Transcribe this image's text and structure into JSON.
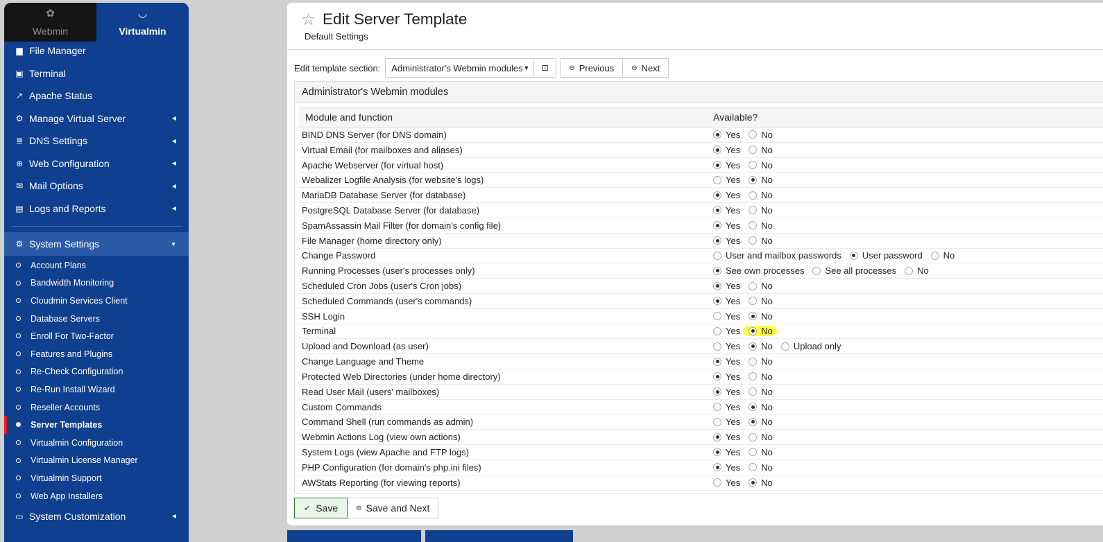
{
  "sidebar": {
    "switch": {
      "webmin": "Webmin",
      "virtualmin": "Virtualmin"
    },
    "items": [
      {
        "label": "File Manager",
        "icon": "folder-icon",
        "glyph": "▆"
      },
      {
        "label": "Terminal",
        "icon": "terminal-icon",
        "glyph": "▣"
      },
      {
        "label": "Apache Status",
        "icon": "external-link-icon",
        "glyph": "↗"
      },
      {
        "label": "Manage Virtual Server",
        "icon": "gears-icon",
        "glyph": "⚙"
      },
      {
        "label": "DNS Settings",
        "icon": "server-icon",
        "glyph": "≣"
      },
      {
        "label": "Web Configuration",
        "icon": "globe-icon",
        "glyph": "⊕"
      },
      {
        "label": "Mail Options",
        "icon": "envelope-icon",
        "glyph": "✉"
      },
      {
        "label": "Logs and Reports",
        "icon": "document-icon",
        "glyph": "▤"
      }
    ],
    "system_settings": {
      "label": "System Settings",
      "icon": "gear-icon"
    },
    "sub_items": [
      "Account Plans",
      "Bandwidth Monitoring",
      "Cloudmin Services Client",
      "Database Servers",
      "Enroll For Two-Factor",
      "Features and Plugins",
      "Re-Check Configuration",
      "Re-Run Install Wizard",
      "Reseller Accounts",
      "Server Templates",
      "Virtualmin Configuration",
      "Virtualmin License Manager",
      "Virtualmin Support",
      "Web App Installers"
    ],
    "current_sub": "Server Templates",
    "customization": {
      "label": "System Customization",
      "icon": "laptop-icon"
    }
  },
  "header": {
    "title": "Edit Server Template",
    "subtitle": "Default Settings"
  },
  "toolbar": {
    "section_label": "Edit template section:",
    "section_value": "Administrator's Webmin modules",
    "previous": "Previous",
    "next": "Next"
  },
  "panel": {
    "title": "Administrator's Webmin modules",
    "col1": "Module and function",
    "col2": "Available?",
    "rows": [
      {
        "name": "BIND DNS Server (for DNS domain)",
        "options": [
          "Yes",
          "No"
        ],
        "selected": 0
      },
      {
        "name": "Virtual Email (for mailboxes and aliases)",
        "options": [
          "Yes",
          "No"
        ],
        "selected": 0
      },
      {
        "name": "Apache Webserver (for virtual host)",
        "options": [
          "Yes",
          "No"
        ],
        "selected": 0
      },
      {
        "name": "Webalizer Logfile Analysis (for website's logs)",
        "options": [
          "Yes",
          "No"
        ],
        "selected": 1
      },
      {
        "name": "MariaDB Database Server (for database)",
        "options": [
          "Yes",
          "No"
        ],
        "selected": 0
      },
      {
        "name": "PostgreSQL Database Server (for database)",
        "options": [
          "Yes",
          "No"
        ],
        "selected": 0
      },
      {
        "name": "SpamAssassin Mail Filter (for domain's config file)",
        "options": [
          "Yes",
          "No"
        ],
        "selected": 0
      },
      {
        "name": "File Manager (home directory only)",
        "options": [
          "Yes",
          "No"
        ],
        "selected": 0
      },
      {
        "name": "Change Password",
        "options": [
          "User and mailbox passwords",
          "User password",
          "No"
        ],
        "selected": 1
      },
      {
        "name": "Running Processes (user's processes only)",
        "options": [
          "See own processes",
          "See all processes",
          "No"
        ],
        "selected": 0
      },
      {
        "name": "Scheduled Cron Jobs (user's Cron jobs)",
        "options": [
          "Yes",
          "No"
        ],
        "selected": 0
      },
      {
        "name": "Scheduled Commands (user's commands)",
        "options": [
          "Yes",
          "No"
        ],
        "selected": 0
      },
      {
        "name": "SSH Login",
        "options": [
          "Yes",
          "No"
        ],
        "selected": 1
      },
      {
        "name": "Terminal",
        "options": [
          "Yes",
          "No"
        ],
        "selected": 1,
        "highlight": true
      },
      {
        "name": "Upload and Download (as user)",
        "options": [
          "Yes",
          "No",
          "Upload only"
        ],
        "selected": 1
      },
      {
        "name": "Change Language and Theme",
        "options": [
          "Yes",
          "No"
        ],
        "selected": 0
      },
      {
        "name": "Protected Web Directories (under home directory)",
        "options": [
          "Yes",
          "No"
        ],
        "selected": 0
      },
      {
        "name": "Read User Mail (users' mailboxes)",
        "options": [
          "Yes",
          "No"
        ],
        "selected": 0
      },
      {
        "name": "Custom Commands",
        "options": [
          "Yes",
          "No"
        ],
        "selected": 1
      },
      {
        "name": "Command Shell (run commands as admin)",
        "options": [
          "Yes",
          "No"
        ],
        "selected": 1
      },
      {
        "name": "Webmin Actions Log (view own actions)",
        "options": [
          "Yes",
          "No"
        ],
        "selected": 0
      },
      {
        "name": "System Logs (view Apache and FTP logs)",
        "options": [
          "Yes",
          "No"
        ],
        "selected": 0
      },
      {
        "name": "PHP Configuration (for domain's php.ini files)",
        "options": [
          "Yes",
          "No"
        ],
        "selected": 0
      },
      {
        "name": "AWStats Reporting (for viewing reports)",
        "options": [
          "Yes",
          "No"
        ],
        "selected": 1
      }
    ]
  },
  "buttons": {
    "save": "Save",
    "save_next": "Save and Next"
  },
  "colors": {
    "sidebar": "#0f3f8f",
    "save_border": "#2e7d32",
    "highlight": "#ffff44",
    "active_marker": "#e02020"
  }
}
